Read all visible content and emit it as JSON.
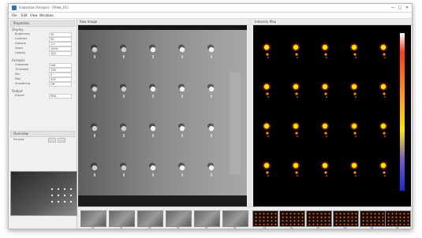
{
  "window": {
    "title": "Inspection Analysis - [Plate_01]",
    "controls": {
      "minimize": "—",
      "maximize": "□",
      "close": "✕"
    }
  },
  "menu": [
    "File",
    "Edit",
    "View",
    "Windows"
  ],
  "left_panel": {
    "title": "Properties",
    "section1": "Display",
    "rows1": [
      {
        "label": "Brightness",
        "value": "50"
      },
      {
        "label": "Contrast",
        "value": "50"
      },
      {
        "label": "Gamma",
        "value": "1.0"
      },
      {
        "label": "Zoom",
        "value": "100%"
      },
      {
        "label": "Opacity",
        "value": "100"
      }
    ],
    "section2": "Analysis",
    "rows2": [
      {
        "label": "Colormap",
        "value": "Hot"
      },
      {
        "label": "Threshold",
        "value": "128"
      },
      {
        "label": "Min",
        "value": "0"
      },
      {
        "label": "Max",
        "value": "255"
      },
      {
        "label": "Smoothing",
        "value": "Off"
      }
    ],
    "section3": "Output",
    "rows3": [
      {
        "label": "Export",
        "value": "PNG"
      }
    ],
    "overview_title": "Overview",
    "overview_label": "Preview"
  },
  "left_view": {
    "title": "Raw Image"
  },
  "right_view": {
    "title": "Intensity Map"
  },
  "strip": {
    "left_labels": [
      "01",
      "02",
      "03",
      "04",
      "05",
      "06"
    ],
    "right_labels": [
      "01",
      "02",
      "03",
      "04",
      "05",
      "06"
    ]
  },
  "colors": {
    "accent": "#2f6fb3",
    "heat_high": "#ffe600",
    "heat_mid": "#ff8c1a",
    "heat_low": "#c0300a"
  }
}
